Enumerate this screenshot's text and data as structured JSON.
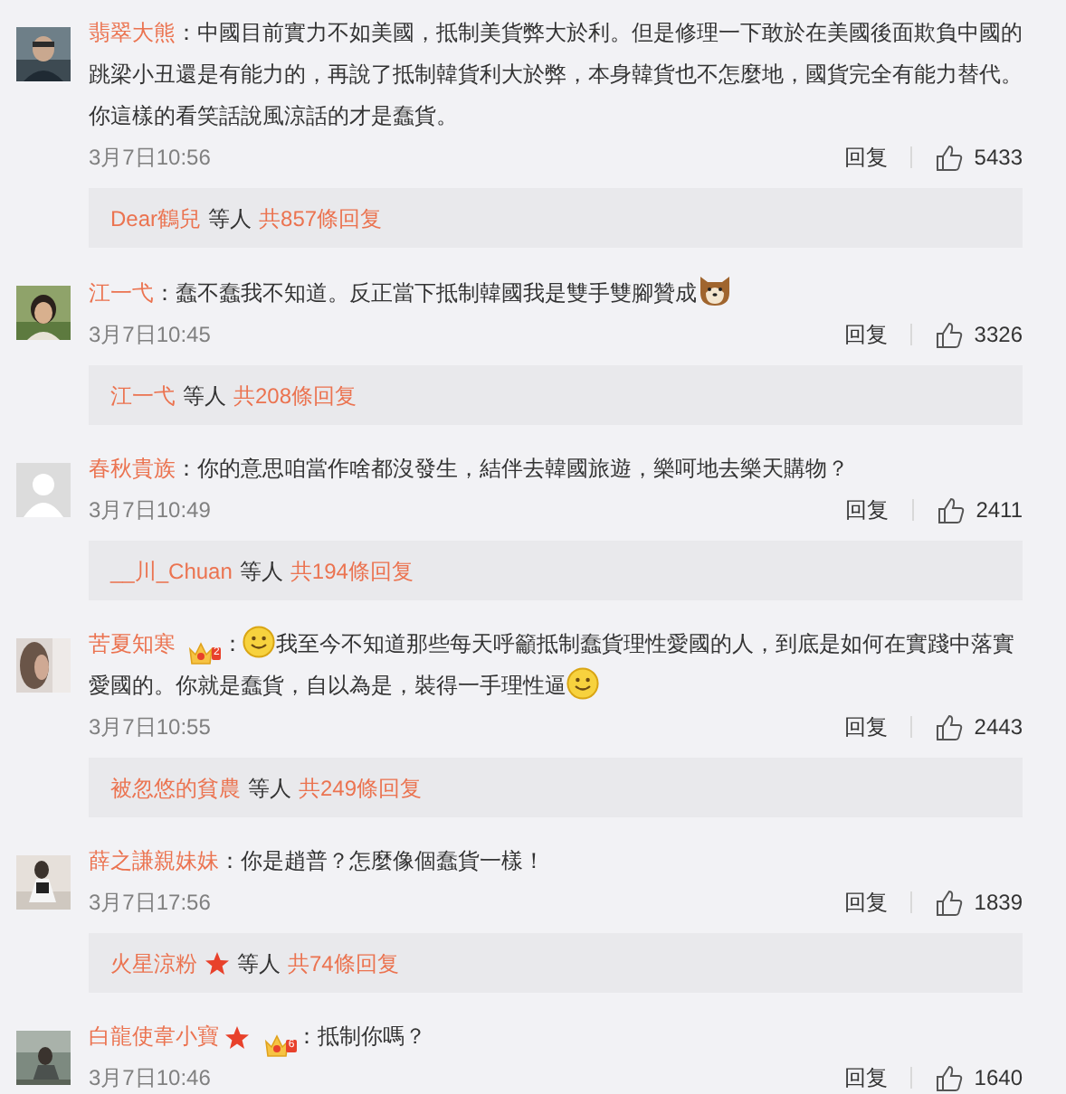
{
  "comments": [
    {
      "avatar": {
        "kind": "picture"
      },
      "user": "翡翠大熊",
      "parts": [
        {
          "kind": "text",
          "text": "：中國目前實力不如美國，抵制美貨弊大於利。但是修理一下敢於在美國後面欺負中國的跳梁小丑還是有能力的，再說了抵制韓貨利大於弊，本身韓貨也不怎麼地，國貨完全有能力替代。你這樣的看笑話說風涼話的才是蠢貨。"
        }
      ],
      "time": "3月7日10:56",
      "reply": "回复",
      "likes": "5433",
      "replies": {
        "user": "Dear鶴兒",
        "others": "等人",
        "total": "共857條回复"
      }
    },
    {
      "avatar": {
        "kind": "picture"
      },
      "user": "江一弋",
      "parts": [
        {
          "kind": "text",
          "text": "：蠢不蠢我不知道。反正當下抵制韓國我是雙手雙腳贊成"
        },
        {
          "kind": "dog"
        }
      ],
      "time": "3月7日10:45",
      "reply": "回复",
      "likes": "3326",
      "replies": {
        "user": "江一弋",
        "others": "等人",
        "total": "共208條回复"
      }
    },
    {
      "avatar": {
        "kind": "default"
      },
      "user": "春秋貴族",
      "parts": [
        {
          "kind": "text",
          "text": "：你的意思咱當作啥都沒發生，結伴去韓國旅遊，樂呵地去樂天購物？"
        }
      ],
      "time": "3月7日10:49",
      "reply": "回复",
      "likes": "2411",
      "replies": {
        "user": "__川_Chuan",
        "others": "等人",
        "total": "共194條回复"
      }
    },
    {
      "avatar": {
        "kind": "picture"
      },
      "user": "苦夏知寒",
      "badges": [
        {
          "kind": "vip",
          "level": "2"
        }
      ],
      "parts": [
        {
          "kind": "text",
          "text": "："
        },
        {
          "kind": "smiley"
        },
        {
          "kind": "text",
          "text": "我至今不知道那些每天呼籲抵制蠢貨理性愛國的人，到底是如何在實踐中落實愛國的。你就是蠢貨，自以為是，裝得一手理性逼"
        },
        {
          "kind": "smiley"
        }
      ],
      "time": "3月7日10:55",
      "reply": "回复",
      "likes": "2443",
      "replies": {
        "user": "被忽悠的貧農",
        "others": "等人",
        "total": "共249條回复"
      }
    },
    {
      "avatar": {
        "kind": "picture"
      },
      "user": "薛之謙親妹妹",
      "parts": [
        {
          "kind": "text",
          "text": "：你是趙普？怎麼像個蠢貨一樣！"
        }
      ],
      "time": "3月7日17:56",
      "reply": "回复",
      "likes": "1839",
      "replies": {
        "user": "火星涼粉",
        "badges": [
          {
            "kind": "star"
          }
        ],
        "others": "等人",
        "total": "共74條回复"
      }
    },
    {
      "avatar": {
        "kind": "picture"
      },
      "user": "白龍使韋小寶",
      "badges": [
        {
          "kind": "star"
        },
        {
          "kind": "vip",
          "level": "6"
        }
      ],
      "parts": [
        {
          "kind": "text",
          "text": "：抵制你嗎？"
        }
      ],
      "time": "3月7日10:46",
      "reply": "回复",
      "likes": "1640"
    }
  ]
}
